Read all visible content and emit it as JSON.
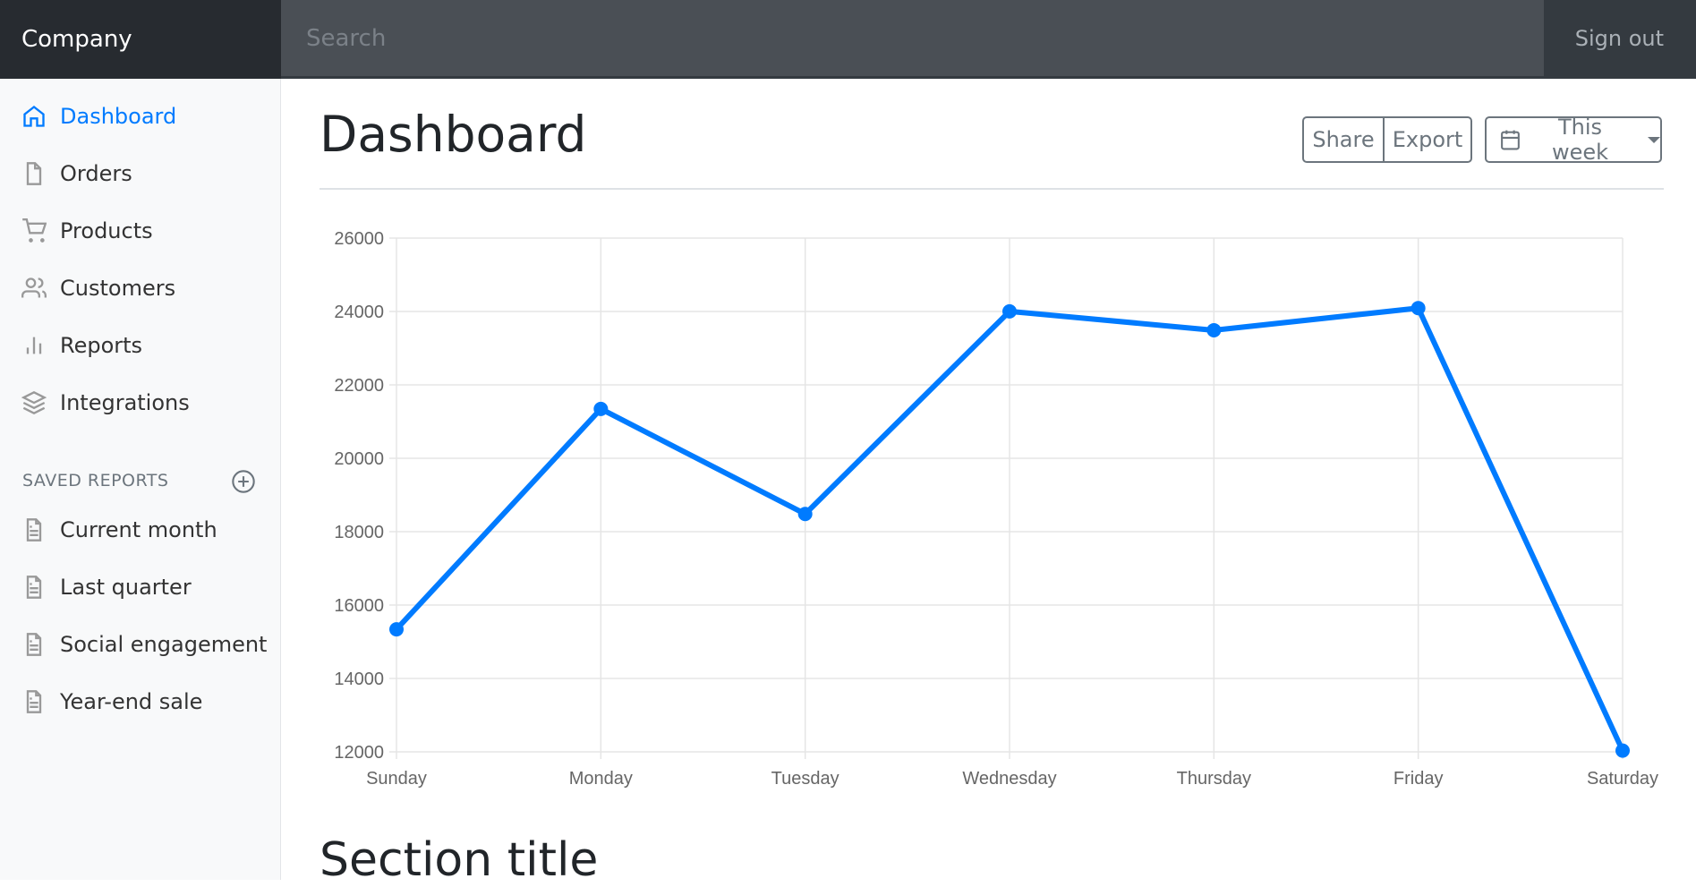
{
  "nav": {
    "brand": "Company",
    "search_placeholder": "Search",
    "signout": "Sign out"
  },
  "sidebar": {
    "items": [
      {
        "label": "Dashboard",
        "icon": "home-icon",
        "active": true
      },
      {
        "label": "Orders",
        "icon": "file-icon"
      },
      {
        "label": "Products",
        "icon": "shopping-cart-icon"
      },
      {
        "label": "Customers",
        "icon": "users-icon"
      },
      {
        "label": "Reports",
        "icon": "bar-chart-icon"
      },
      {
        "label": "Integrations",
        "icon": "layers-icon"
      }
    ],
    "saved_heading": "SAVED REPORTS",
    "saved": [
      {
        "label": "Current month"
      },
      {
        "label": "Last quarter"
      },
      {
        "label": "Social engagement"
      },
      {
        "label": "Year-end sale"
      }
    ]
  },
  "main": {
    "title": "Dashboard",
    "share": "Share",
    "export": "Export",
    "range": "This week",
    "section_title": "Section title"
  },
  "colors": {
    "accent": "#007bff"
  },
  "chart_data": {
    "type": "line",
    "categories": [
      "Sunday",
      "Monday",
      "Tuesday",
      "Wednesday",
      "Thursday",
      "Friday",
      "Saturday"
    ],
    "values": [
      15339,
      21345,
      18483,
      24003,
      23489,
      24092,
      12034
    ],
    "ylim": [
      12000,
      26000
    ],
    "yticks": [
      "12000",
      "14000",
      "16000",
      "18000",
      "20000",
      "22000",
      "24000",
      "26000"
    ],
    "grid": true,
    "color": "#007bff"
  }
}
